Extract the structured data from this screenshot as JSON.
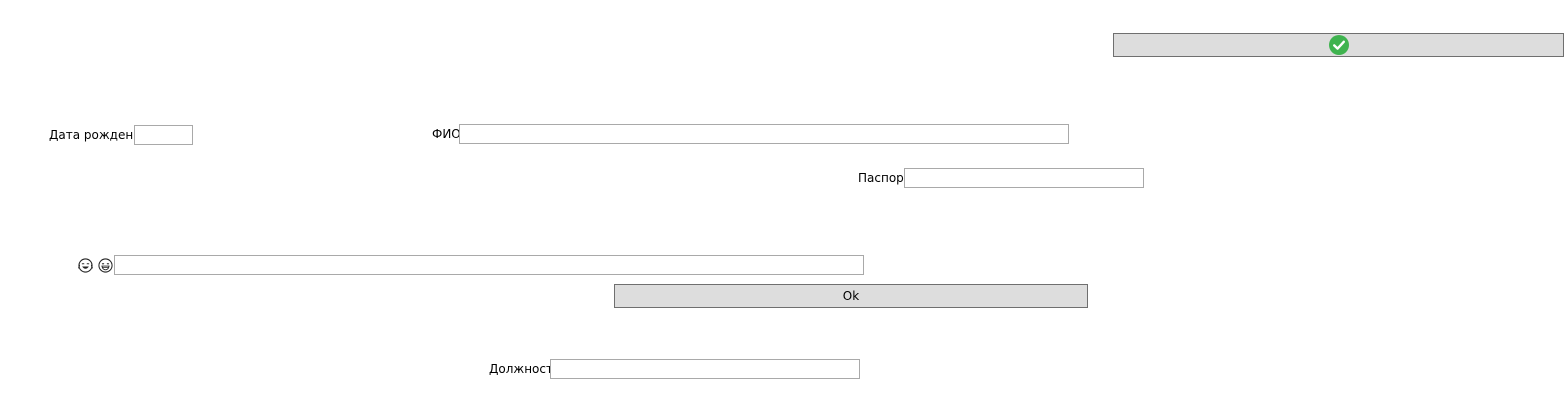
{
  "confirm_button": {
    "icon": "check-circle-icon",
    "accent": "#3fb34f"
  },
  "fields": {
    "birth_date_label": "Дата рождения",
    "birth_date_value": "",
    "fio_label": "ФИО",
    "fio_value": "",
    "passport_label": "Паспорт",
    "passport_value": "",
    "emoji_field_value": "",
    "position_label": "Должность",
    "position_value": ""
  },
  "emoji_icons": [
    "face-with-tears-of-joy-icon",
    "grinning-face-icon"
  ],
  "ok_button": {
    "label": "Ok"
  }
}
